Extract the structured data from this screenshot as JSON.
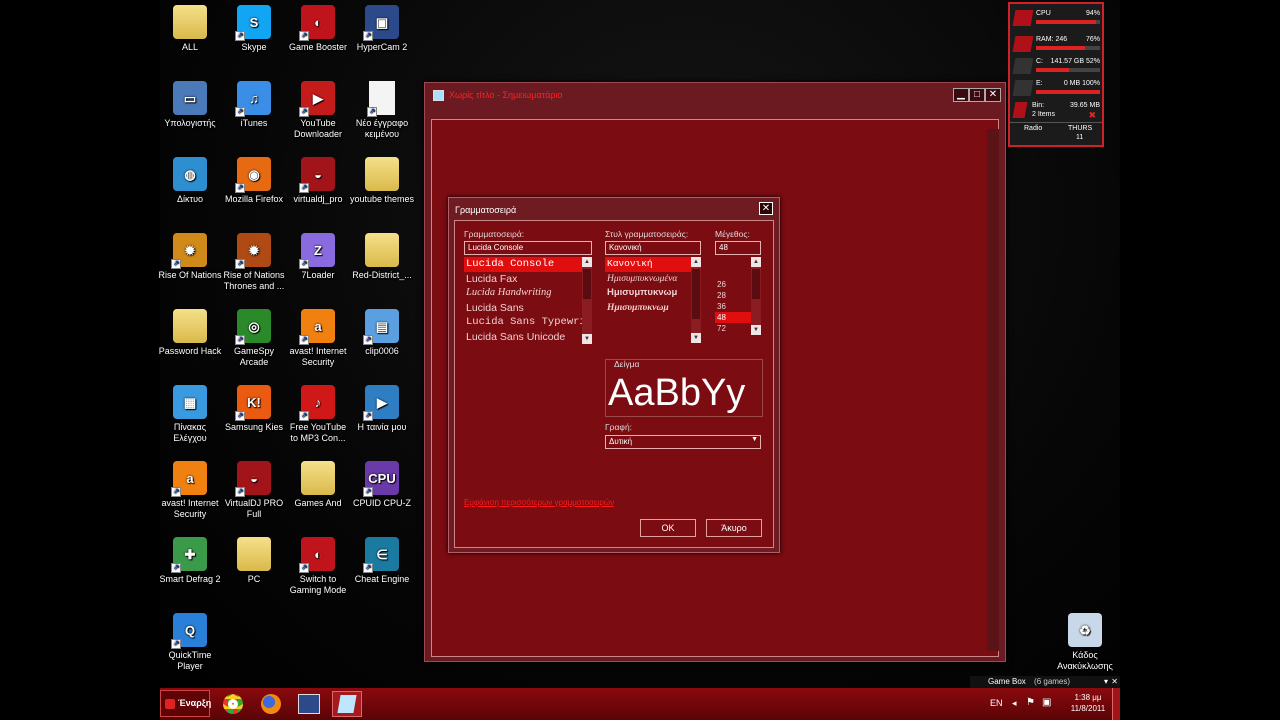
{
  "desktop_icons": [
    {
      "label": "ALL",
      "icon": "folder-icon",
      "name": "all"
    },
    {
      "label": "Skype",
      "icon": "skype-icon",
      "name": "skype",
      "color": "#12a5f4",
      "glyph": "S"
    },
    {
      "label": "Game Booster",
      "icon": "game-booster-icon",
      "name": "game-booster",
      "color": "#c0141c",
      "glyph": "◐"
    },
    {
      "label": "HyperCam 2",
      "icon": "hypercam-icon",
      "name": "hypercam",
      "color": "#2c4a8a",
      "glyph": "▣"
    },
    {
      "label": "Υπολογιστής",
      "icon": "computer-icon",
      "name": "computer",
      "color": "#4a7ab8",
      "glyph": "▭"
    },
    {
      "label": "iTunes",
      "icon": "itunes-icon",
      "name": "itunes",
      "color": "#3a8ee6",
      "glyph": "♫"
    },
    {
      "label": "YouTube Downloader",
      "icon": "youtube-downloader-icon",
      "name": "youtube-downloader",
      "color": "#c41b1b",
      "glyph": "▶"
    },
    {
      "label": "Νέο έγγραφο κειμένου",
      "icon": "text-document-icon",
      "name": "new-text-document",
      "color": "#f4f4f4",
      "glyph": ""
    },
    {
      "label": "Δίκτυο",
      "icon": "network-icon",
      "name": "network",
      "color": "#2d8fd0",
      "glyph": "◍"
    },
    {
      "label": "Mozilla Firefox",
      "icon": "firefox-icon",
      "name": "firefox",
      "color": "#e66a12",
      "glyph": "◉"
    },
    {
      "label": "virtualdj_pro",
      "icon": "virtualdj-icon",
      "name": "virtualdj-pro",
      "color": "#a0141a",
      "glyph": "◒"
    },
    {
      "label": "youtube themes",
      "icon": "folder-icon",
      "name": "youtube-themes"
    },
    {
      "label": "Rise Of Nations",
      "icon": "rise-of-nations-icon",
      "name": "rise-of-nations",
      "color": "#d08a1a",
      "glyph": "✹"
    },
    {
      "label": "Rise of Nations Thrones and ...",
      "icon": "rise-of-nations-thrones-icon",
      "name": "rise-of-nations-thrones",
      "color": "#b04a14",
      "glyph": "✹"
    },
    {
      "label": "7Loader",
      "icon": "7loader-icon",
      "name": "7loader",
      "color": "#8a6adf",
      "glyph": "Z"
    },
    {
      "label": "Red-District_...",
      "icon": "folder-icon",
      "name": "red-district"
    },
    {
      "label": "Password Hack",
      "icon": "folder-icon",
      "name": "password-hack"
    },
    {
      "label": "GameSpy Arcade",
      "icon": "gamespy-icon",
      "name": "gamespy-arcade",
      "color": "#2a8a2a",
      "glyph": "◎"
    },
    {
      "label": "avast! Internet Security",
      "icon": "avast-icon",
      "name": "avast-1",
      "color": "#f08010",
      "glyph": "a"
    },
    {
      "label": "clip0006",
      "icon": "video-clip-icon",
      "name": "clip0006",
      "color": "#5aa0e0",
      "glyph": "▤"
    },
    {
      "label": "Πίνακας Ελέγχου",
      "icon": "control-panel-icon",
      "name": "control-panel",
      "color": "#3a9ae0",
      "glyph": "▦"
    },
    {
      "label": "Samsung Kies",
      "icon": "samsung-kies-icon",
      "name": "samsung-kies",
      "color": "#ea5a10",
      "glyph": "K!"
    },
    {
      "label": "Free YouTube to MP3 Con...",
      "icon": "youtube-mp3-icon",
      "name": "youtube-mp3",
      "color": "#d01818",
      "glyph": "♪"
    },
    {
      "label": "Η ταινία μου",
      "icon": "movie-icon",
      "name": "my-movie",
      "color": "#2f7ec4",
      "glyph": "▶"
    },
    {
      "label": "avast! Internet Security",
      "icon": "avast-icon",
      "name": "avast-2",
      "color": "#f08010",
      "glyph": "a"
    },
    {
      "label": "VirtualDJ PRO Full",
      "icon": "virtualdj-icon",
      "name": "virtualdj-pro-full",
      "color": "#a0141a",
      "glyph": "◒"
    },
    {
      "label": "Games And",
      "icon": "folder-icon",
      "name": "games-and"
    },
    {
      "label": "CPUID CPU-Z",
      "icon": "cpuz-icon",
      "name": "cpuz",
      "color": "#6a3aa8",
      "glyph": "CPU"
    },
    {
      "label": "Smart Defrag 2",
      "icon": "smart-defrag-icon",
      "name": "smart-defrag",
      "color": "#3a9a4a",
      "glyph": "✚"
    },
    {
      "label": "PC",
      "icon": "folder-icon",
      "name": "pc"
    },
    {
      "label": "Switch to Gaming Mode",
      "icon": "gaming-mode-icon",
      "name": "gaming-mode",
      "color": "#c0141c",
      "glyph": "◐"
    },
    {
      "label": "Cheat Engine",
      "icon": "cheat-engine-icon",
      "name": "cheat-engine",
      "color": "#1a7aa0",
      "glyph": "∈"
    },
    {
      "label": "QuickTime Player",
      "icon": "quicktime-icon",
      "name": "quicktime",
      "color": "#2a80d8",
      "glyph": "Q"
    },
    {
      "label": "Κάδος Ανακύκλωσης",
      "icon": "recycle-bin-icon",
      "name": "recycle-bin",
      "color": "#c8d8e8",
      "glyph": "♻"
    }
  ],
  "main_window": {
    "title": "Χωρίς τίτλο - Σημειωματάριο",
    "min": "▁",
    "max": "□",
    "close": "✕"
  },
  "font_dialog": {
    "title": "Γραμματοσειρά",
    "close": "✕",
    "font_label": "Γραμματοσειρά:",
    "font_value": "Lucida Console",
    "fonts": [
      "Lucida Console",
      "Lucida Fax",
      "Lucida Handwriting",
      "Lucida Sans",
      "Lucida Sans Typewriter",
      "Lucida Sans Unicode"
    ],
    "style_label": "Στυλ γραμματοσειράς:",
    "style_value": "Κανονική",
    "styles": [
      "Κανονική",
      "Ημισυμπυκνωμένα",
      "Ημισυμπυκνωμ",
      "Ημισυμπυκνωμ"
    ],
    "size_label": "Μέγεθος:",
    "size_value": "48",
    "sizes": [
      "",
      "",
      "26",
      "28",
      "36",
      "48",
      "72"
    ],
    "sample_label": "Δείγμα",
    "sample_text": "AaBbYy",
    "script_label": "Γραφή:",
    "script_value": "Δυτική",
    "more_fonts_link": "Εμφάνιση περισσότερων γραμματοσειρών",
    "ok": "OK",
    "cancel": "Άκυρο"
  },
  "gadget": {
    "cpu_label": "CPU",
    "cpu_value": "94%",
    "cpu_pct": 94,
    "ram_label": "RAM: 246",
    "ram_value": "76%",
    "ram_pct": 76,
    "c_label": "C:",
    "c_value": "141.57 GB 52%",
    "c_pct": 52,
    "e_label": "E:",
    "e_value": "0 MB 100%",
    "e_pct": 100,
    "bin_label": "Bin:",
    "bin_value": "39.65 MB",
    "bin_items": "2 Items",
    "radio": "Radio",
    "day": "THURS",
    "date": "11"
  },
  "taskbar": {
    "start": "Έναρξη",
    "lang": "EN",
    "time": "1:38 μμ",
    "date": "11/8/2011",
    "gamebox": "Game Box",
    "gamebox_count": "(6 games)"
  }
}
